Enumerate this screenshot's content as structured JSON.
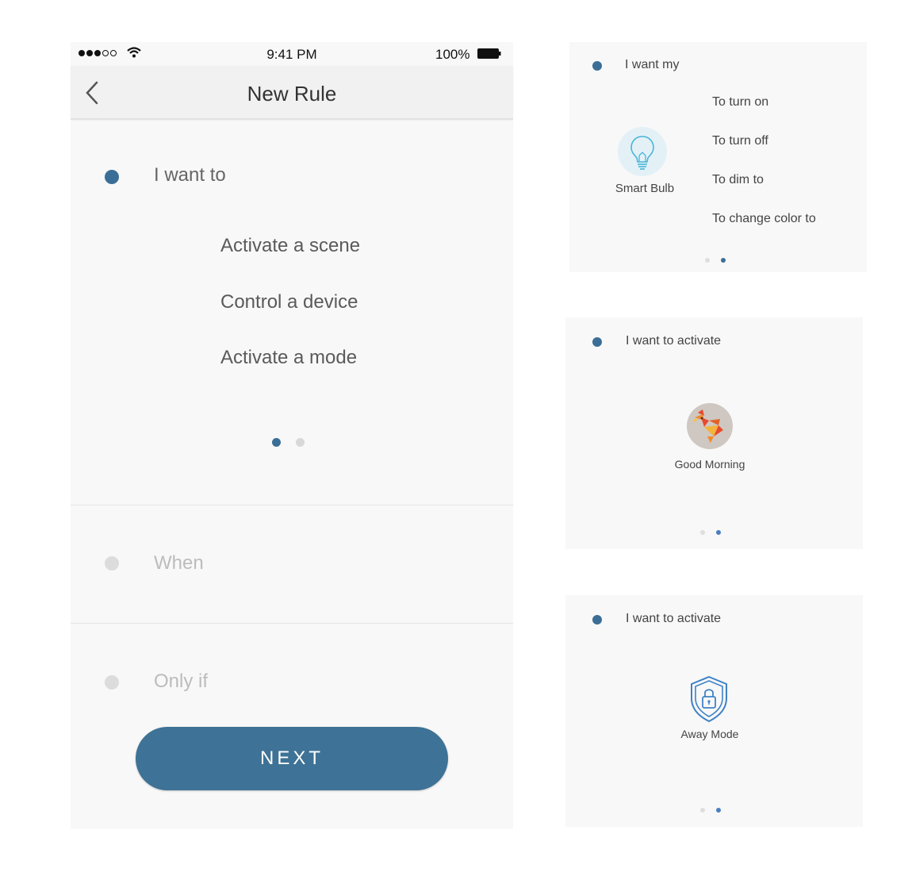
{
  "phone": {
    "status_bar": {
      "time": "9:41 PM",
      "battery": "100%"
    },
    "nav": {
      "title": "New Rule"
    },
    "steps": {
      "i_want_to": "I want to",
      "when": "When",
      "only_if": "Only if"
    },
    "options": [
      "Activate a scene",
      "Control a device",
      "Activate a mode"
    ],
    "next_label": "NEXT"
  },
  "card_device": {
    "title": "I want my",
    "device_name": "Smart Bulb",
    "device_icon": "lightbulb-icon",
    "actions": [
      "To turn on",
      "To turn off",
      "To dim to",
      "To change color to"
    ]
  },
  "card_scene": {
    "title": "I want to activate",
    "scene_name": "Good Morning",
    "scene_icon": "rooster-icon"
  },
  "card_mode": {
    "title": "I want to activate",
    "mode_name": "Away Mode",
    "mode_icon": "shield-lock-icon"
  },
  "colors": {
    "accent": "#3e7296",
    "inactive": "#dcdcdc"
  }
}
